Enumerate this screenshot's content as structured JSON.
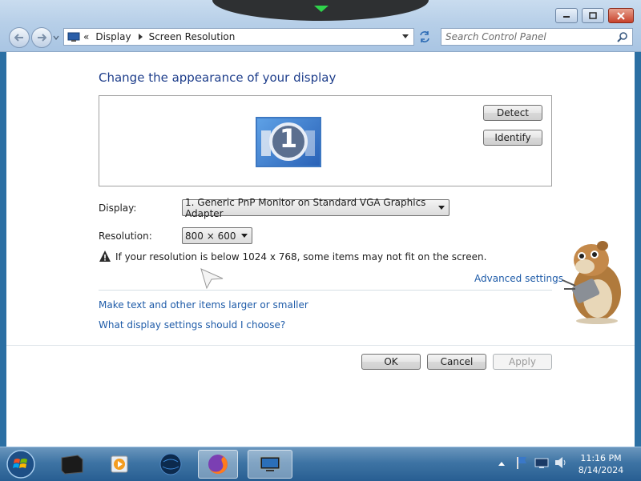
{
  "window": {
    "controls": [
      "minimize",
      "maximize",
      "close"
    ]
  },
  "address_bar": {
    "breadcrumb_prefix": "«",
    "crumbs": [
      "Display",
      "Screen Resolution"
    ]
  },
  "search": {
    "placeholder": "Search Control Panel"
  },
  "content": {
    "title": "Change the appearance of your display",
    "monitor_number": "1",
    "detect_label": "Detect",
    "identify_label": "Identify",
    "display_label": "Display:",
    "display_value": "1. Generic PnP Monitor on Standard VGA Graphics Adapter",
    "resolution_label": "Resolution:",
    "resolution_value": "800 × 600",
    "warning_text": "If your resolution is below 1024 x 768, some items may not fit on the screen.",
    "advanced_settings_link": "Advanced settings",
    "link_text_size": "Make text and other items larger or smaller",
    "link_display_help": "What display settings should I choose?",
    "ok_label": "OK",
    "cancel_label": "Cancel",
    "apply_label": "Apply"
  },
  "taskbar": {
    "apps": [
      "monitor-app",
      "media-player",
      "globe-app",
      "firefox",
      "screen-resolution-window"
    ],
    "time": "11:16 PM",
    "date": "8/14/2024"
  },
  "colors": {
    "title_blue": "#1e3e8b",
    "link_blue": "#1e5ba8",
    "taskbar": "#285e92"
  }
}
